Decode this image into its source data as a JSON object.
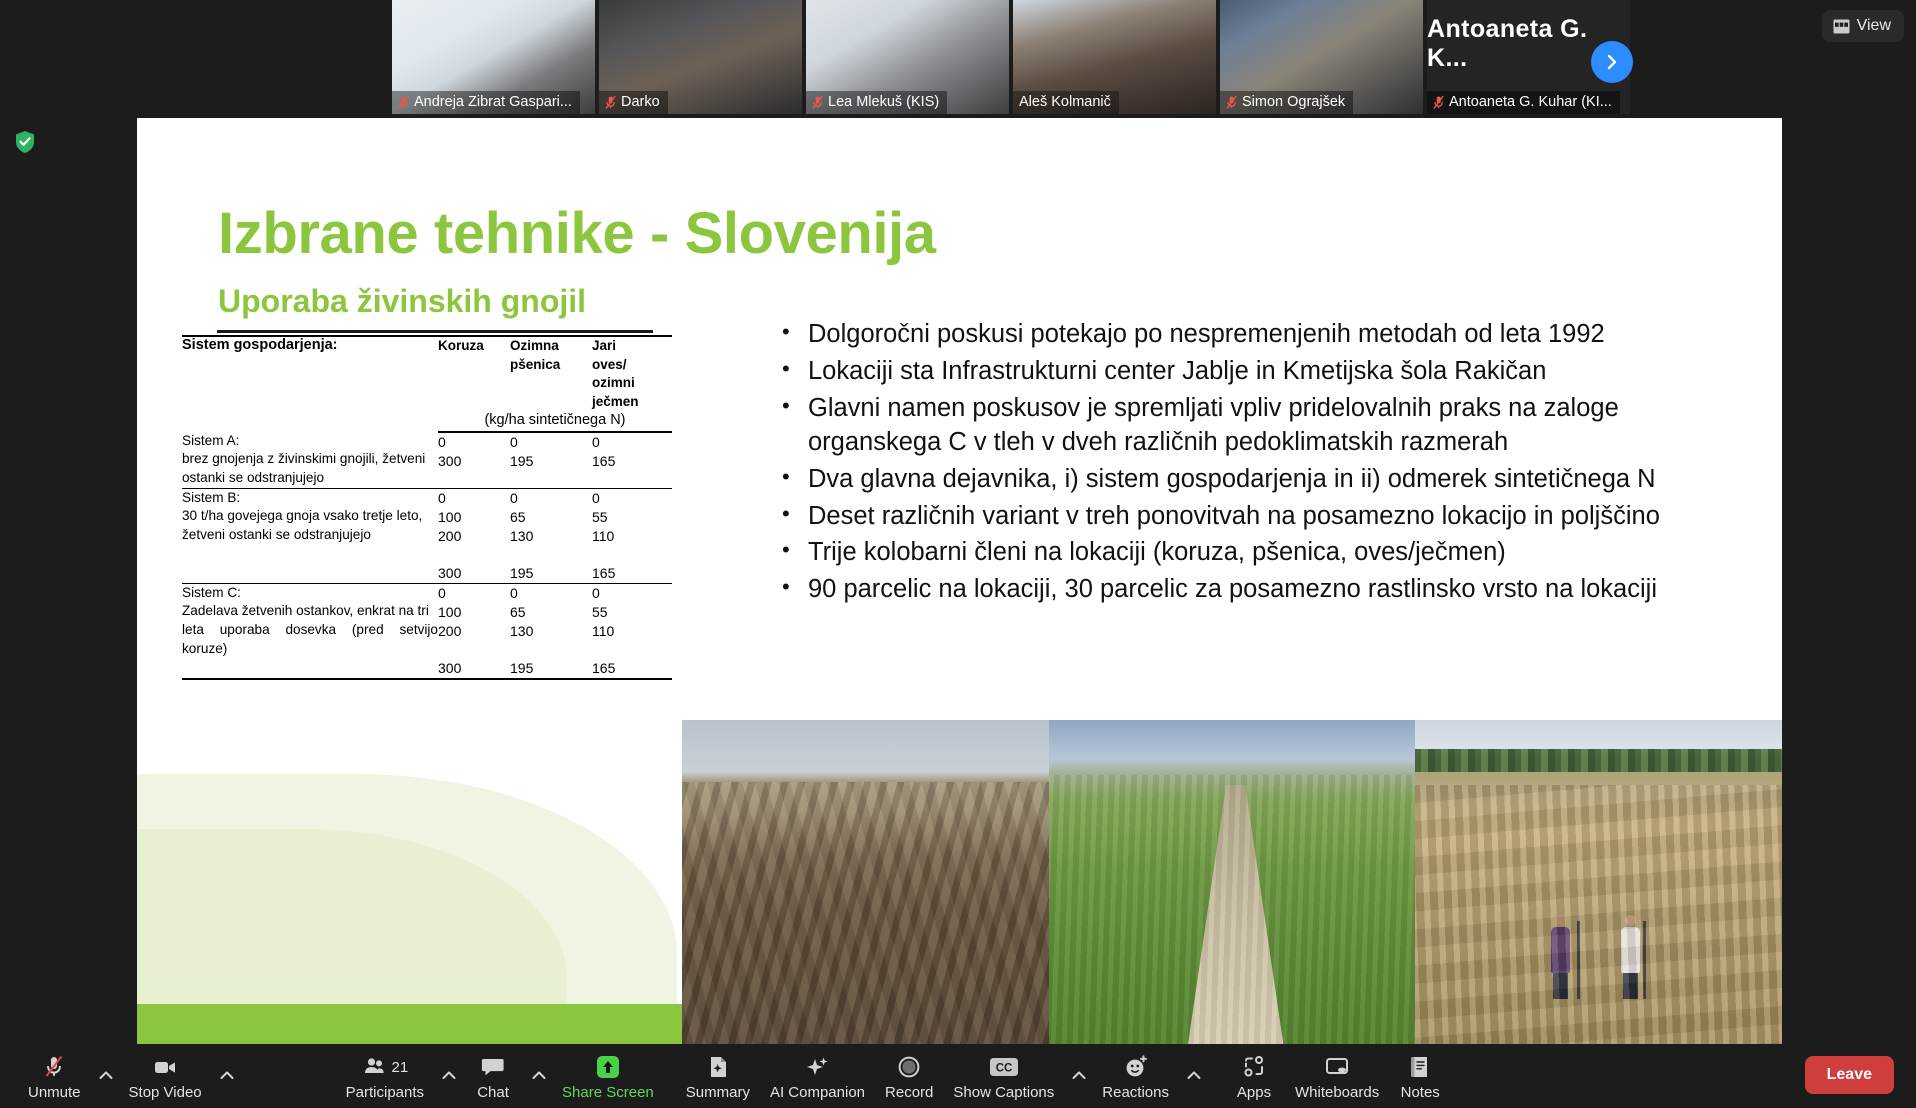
{
  "window": {
    "title": "Zoom Meeting",
    "view_button_label": "View",
    "view_icon": "grid-view-icon",
    "security_icon": "shield-check-icon"
  },
  "video_strip": {
    "next_icon": "chevron-right-icon",
    "mic_icon": "microphone-muted-icon",
    "participants": [
      {
        "name": "Andreja Zibrat Gaspari...",
        "muted": true,
        "active": false
      },
      {
        "name": "Darko",
        "muted": true,
        "active": false
      },
      {
        "name": "Lea Mlekuš (KIS)",
        "muted": true,
        "active": false
      },
      {
        "name": "Aleš Kolmanič",
        "muted": false,
        "active": true
      },
      {
        "name": "Simon Ograjšek",
        "muted": true,
        "active": false
      },
      {
        "name": "Antoaneta G. Kuhar (KI...",
        "muted": true,
        "active": false,
        "big_label": "Antoaneta G. K..."
      }
    ]
  },
  "slide": {
    "title": "Izbrane tehnike - Slovenija",
    "subtitle": "Uporaba živinskih gnojil",
    "table": {
      "header_label": "Sistem gospodarjenja:",
      "columns": [
        "Koruza",
        "Ozimna pšenica",
        "Jari oves/ ozimni ječmen"
      ],
      "unit_note": "(kg/ha sintetičnega N)",
      "rows": [
        {
          "name": "Sistem A:",
          "description": "brez gnojenja z živinskimi gnojili, žetveni ostanki se odstranjujejo",
          "desc_lines": [
            "brez  gnojenja  z  živinskimi  gnojili,  žetveni",
            "ostanki se odstranjujejo"
          ],
          "values": [
            [
              "0",
              "0",
              "0"
            ],
            [
              "300",
              "195",
              "165"
            ]
          ]
        },
        {
          "name": "Sistem B:",
          "description": "30 t/ha govejega gnoja vsako tretje leto, žetveni ostanki se odstranjujejo",
          "desc_lines": [
            "30  t/ha  govejega  gnoja  vsako  tretje  leto,",
            "žetveni ostanki se odstranjujejo"
          ],
          "values": [
            [
              "0",
              "0",
              "0"
            ],
            [
              "100",
              "65",
              "55"
            ],
            [
              "200",
              "130",
              "110"
            ],
            [
              "300",
              "195",
              "165"
            ]
          ]
        },
        {
          "name": "Sistem C:",
          "description": "Zadelava žetvenih ostankov, enkrat na tri leta uporaba dosevka (pred setvijo koruze)",
          "desc_lines": [
            "Zadelava  žetvenih  ostankov,  enkrat  na  tri",
            "leta uporaba dosevka (pred setvijo koruze)"
          ],
          "values": [
            [
              "0",
              "0",
              "0"
            ],
            [
              "100",
              "65",
              "55"
            ],
            [
              "200",
              "130",
              "110"
            ],
            [
              "300",
              "195",
              "165"
            ]
          ]
        }
      ]
    },
    "bullets": [
      "Dolgoročni poskusi potekajo po nespremenjenih metodah od leta 1992",
      "Lokaciji sta Infrastrukturni center Jablje in Kmetijska šola Rakičan",
      "Glavni namen poskusov je spremljati vpliv pridelovalnih praks na zaloge organskega C v tleh v dveh različnih pedoklimatskih razmerah",
      "Dva glavna dejavnika, i) sistem gospodarjenja in ii) odmerek sintetičnega N",
      "Deset različnih variant v treh ponovitvah na posamezno lokacijo in poljščino",
      "Trije kolobarni členi na lokaciji (koruza, pšenica, oves/ječmen)",
      "90 parcelic na lokaciji, 30 parcelic za posamezno rastlinsko vrsto na lokaciji"
    ],
    "photos": [
      {
        "caption": "ploughed-field-with-manure"
      },
      {
        "caption": "green-wheat-field-with-path-and-church"
      },
      {
        "caption": "researchers-sampling-on-stubble-field"
      }
    ],
    "accent_color": "#8cc63e"
  },
  "toolbar": {
    "items": [
      {
        "id": "unmute",
        "label": "Unmute",
        "icon": "microphone-muted-icon",
        "caret": true,
        "green": false
      },
      {
        "id": "stop-video",
        "label": "Stop Video",
        "icon": "video-camera-icon",
        "caret": true,
        "green": false
      },
      {
        "id": "participants",
        "label": "Participants",
        "icon": "people-icon",
        "caret": true,
        "green": false,
        "count": "21"
      },
      {
        "id": "chat",
        "label": "Chat",
        "icon": "speech-bubble-icon",
        "caret": true,
        "green": false
      },
      {
        "id": "share-screen",
        "label": "Share Screen",
        "icon": "share-up-arrow-icon",
        "caret": false,
        "green": true
      },
      {
        "id": "summary",
        "label": "Summary",
        "icon": "document-sparkle-icon",
        "caret": false,
        "green": false
      },
      {
        "id": "ai-companion",
        "label": "AI Companion",
        "icon": "sparkle-icon",
        "caret": false,
        "green": false
      },
      {
        "id": "record",
        "label": "Record",
        "icon": "record-circle-icon",
        "caret": false,
        "green": false
      },
      {
        "id": "show-captions",
        "label": "Show Captions",
        "icon": "cc-icon",
        "caret": true,
        "green": false
      },
      {
        "id": "reactions",
        "label": "Reactions",
        "icon": "smiley-plus-icon",
        "caret": true,
        "green": false
      },
      {
        "id": "apps",
        "label": "Apps",
        "icon": "apps-icon",
        "caret": false,
        "green": false
      },
      {
        "id": "whiteboards",
        "label": "Whiteboards",
        "icon": "whiteboard-icon",
        "caret": false,
        "green": false
      },
      {
        "id": "notes",
        "label": "Notes",
        "icon": "notes-icon",
        "caret": false,
        "green": false
      }
    ],
    "leave_label": "Leave"
  }
}
